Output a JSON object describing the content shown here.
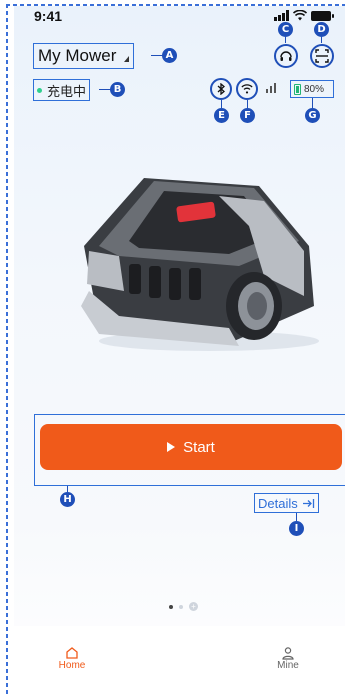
{
  "status_bar": {
    "time": "9:41"
  },
  "header": {
    "device_name": "My Mower",
    "status_text": "充电中",
    "battery_percent": "80%",
    "signal_bars": 3
  },
  "annotations": {
    "A": "A",
    "B": "B",
    "C": "C",
    "D": "D",
    "E": "E",
    "F": "F",
    "G": "G",
    "H": "H",
    "I": "I"
  },
  "actions": {
    "start_label": "Start",
    "details_label": "Details"
  },
  "pager": {
    "count": 2,
    "active_index": 0
  },
  "tabbar": {
    "items": [
      {
        "label": "Home",
        "icon": "home-icon",
        "active": true
      },
      {
        "label": "Mine",
        "icon": "user-icon",
        "active": false
      }
    ]
  },
  "colors": {
    "accent": "#f05a1a",
    "annotation": "#1f4fb8",
    "status_dot": "#2ecf8e",
    "battery": "#22b573"
  }
}
